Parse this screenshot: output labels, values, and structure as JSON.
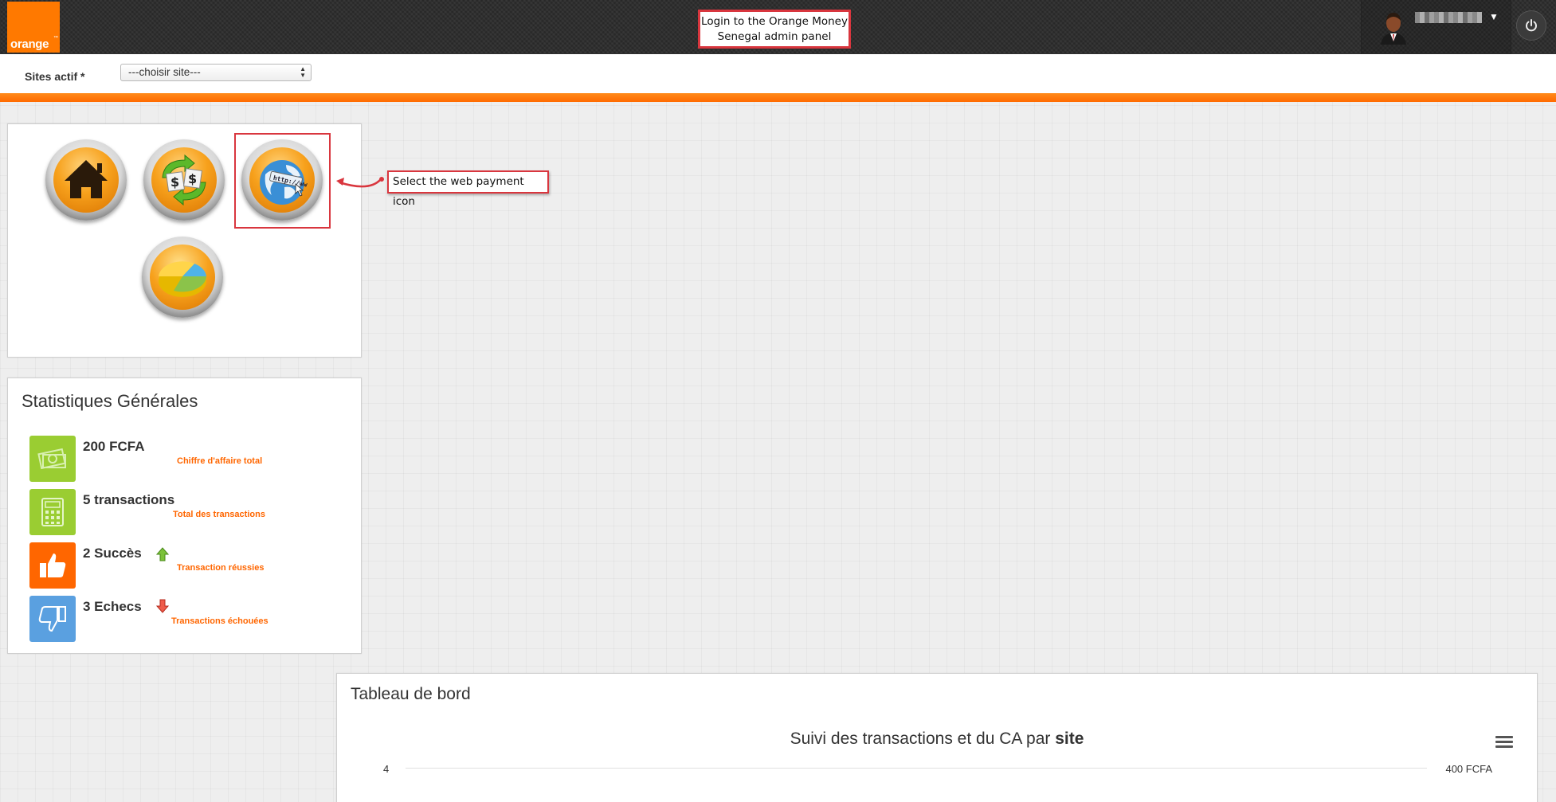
{
  "header": {
    "logo_text": "orange",
    "logo_tm": "™",
    "callout": "Login to the Orange Money Senegal admin panel",
    "brand_color": "#ff7900"
  },
  "site_selector": {
    "label": "Sites actif *",
    "selected": "---choisir site---"
  },
  "icon_panel": {
    "icons": [
      {
        "name": "home-icon"
      },
      {
        "name": "money-exchange-icon"
      },
      {
        "name": "web-payment-icon"
      },
      {
        "name": "pie-chart-icon"
      }
    ],
    "callout": "Select the web payment icon"
  },
  "stats": {
    "title": "Statistiques Générales",
    "items": [
      {
        "value": "200 FCFA",
        "label": "Chiffre d'affaire total",
        "icon": "money-icon",
        "color": "#9acd32"
      },
      {
        "value": "5 transactions",
        "label": "Total des transactions",
        "icon": "calculator-icon",
        "color": "#9acd32"
      },
      {
        "value": "2 Succès",
        "label": "Transaction réussies",
        "icon": "thumbs-up-icon",
        "color": "#ff6600"
      },
      {
        "value": "3 Echecs",
        "label": "Transactions échouées",
        "icon": "thumbs-down-icon",
        "color": "#5aa0e0"
      }
    ]
  },
  "dashboard": {
    "title": "Tableau de bord",
    "chart_title_prefix": "Suivi des transactions et du CA par ",
    "chart_title_bold": "site",
    "y_left_top": "4",
    "y_right_top": "400 FCFA"
  }
}
